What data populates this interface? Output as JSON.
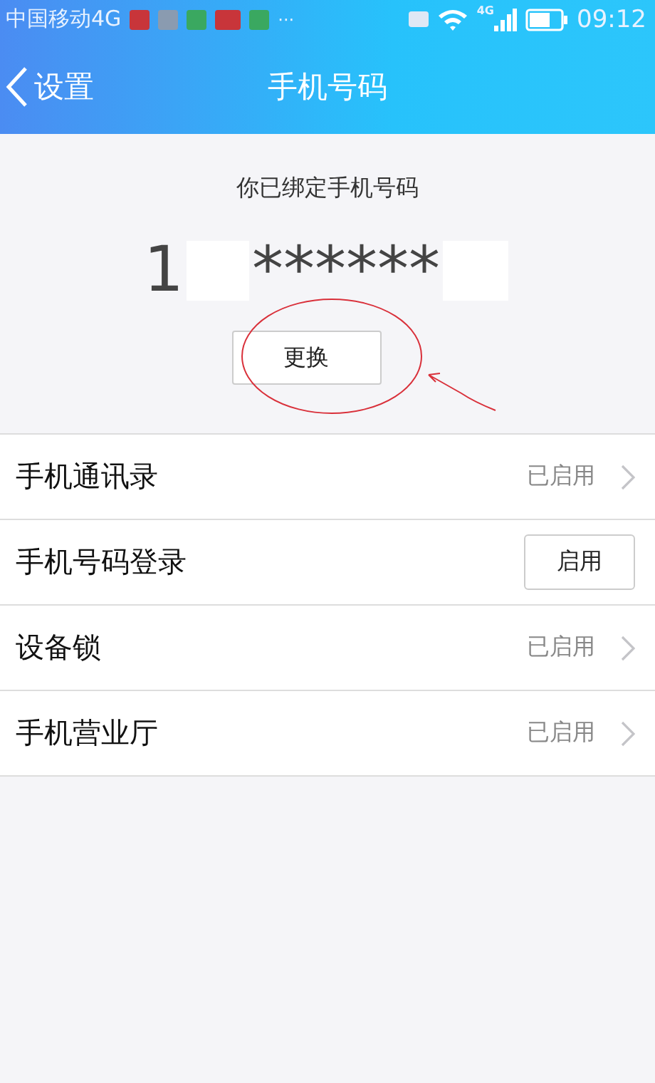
{
  "status_bar": {
    "carrier": "中国移动4G",
    "more": "···",
    "network": "4G",
    "time": "09:12"
  },
  "nav_bar": {
    "back": "设置",
    "title": "手机号码"
  },
  "binding": {
    "caption": "你已绑定手机号码",
    "number_start": "1",
    "number_mask": "******",
    "button": "更换"
  },
  "rows": [
    {
      "kind": "status",
      "label": "手机通讯录",
      "value": "已启用"
    },
    {
      "kind": "button",
      "label": "手机号码登录",
      "button": "启用"
    },
    {
      "kind": "status",
      "label": "设备锁",
      "value": "已启用"
    },
    {
      "kind": "status",
      "label": "手机营业厅",
      "value": "已启用"
    }
  ]
}
